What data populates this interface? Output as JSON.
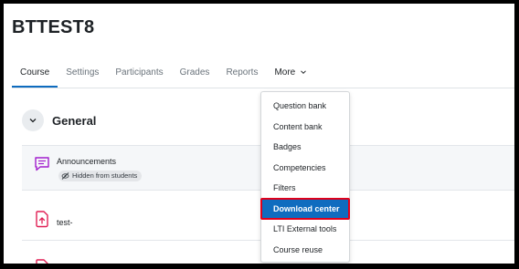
{
  "page": {
    "title": "BTTEST8"
  },
  "nav": {
    "tabs": [
      {
        "label": "Course"
      },
      {
        "label": "Settings"
      },
      {
        "label": "Participants"
      },
      {
        "label": "Grades"
      },
      {
        "label": "Reports"
      }
    ],
    "more_label": "More"
  },
  "section": {
    "title": "General"
  },
  "activities": [
    {
      "name": "Announcements",
      "badge": "Hidden from students",
      "icon": "forum-icon"
    },
    {
      "name": "test-",
      "icon": "file-upload-icon"
    },
    {
      "name": "",
      "icon": "file-upload-icon"
    }
  ],
  "more_menu": {
    "items": [
      {
        "label": "Question bank"
      },
      {
        "label": "Content bank"
      },
      {
        "label": "Badges"
      },
      {
        "label": "Competencies"
      },
      {
        "label": "Filters"
      },
      {
        "label": "Download center",
        "highlighted": true
      },
      {
        "label": "LTI External tools"
      },
      {
        "label": "Course reuse"
      }
    ]
  },
  "colors": {
    "accent": "#0f6cbf",
    "highlight_border": "#e0001b",
    "icon_purple": "#a21ecd",
    "icon_pink": "#e01f54"
  }
}
